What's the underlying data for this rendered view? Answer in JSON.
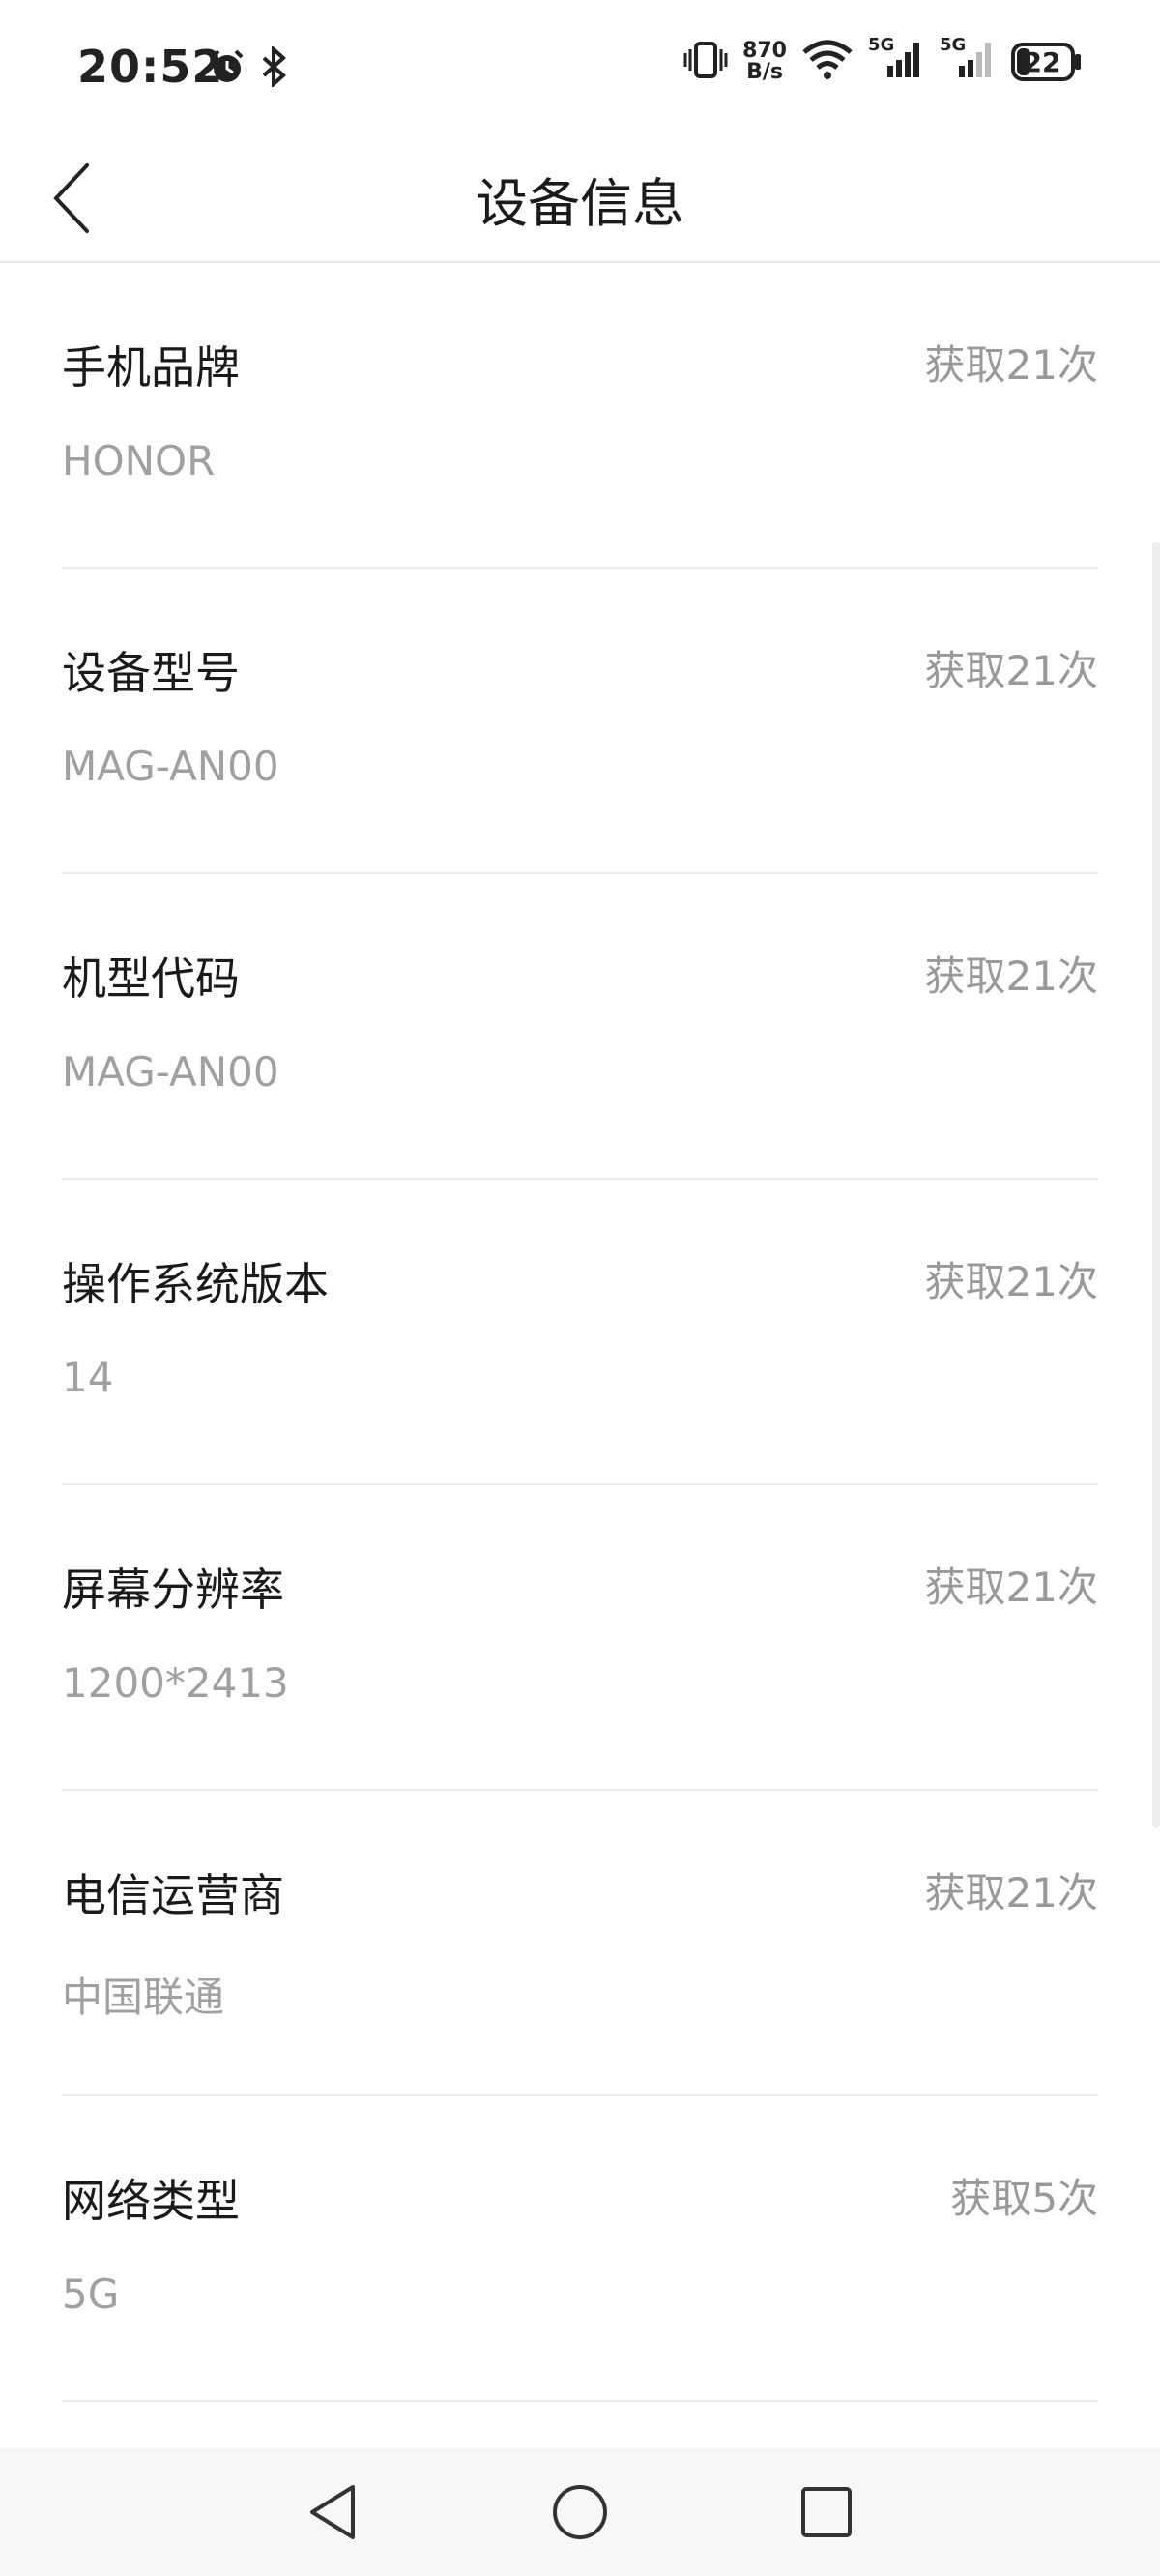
{
  "status_bar": {
    "time": "20:52",
    "speed_value": "870",
    "speed_unit": "B/s",
    "network1": "5G",
    "network2": "5G",
    "battery": "22",
    "icons": [
      "alarm-icon",
      "bluetooth-icon",
      "vibrate-icon",
      "wifi-icon",
      "signal-icon",
      "signal-icon",
      "battery-icon"
    ]
  },
  "header": {
    "title": "设备信息"
  },
  "items": [
    {
      "label": "手机品牌",
      "count": "获取21次",
      "value": "HONOR"
    },
    {
      "label": "设备型号",
      "count": "获取21次",
      "value": "MAG-AN00"
    },
    {
      "label": "机型代码",
      "count": "获取21次",
      "value": "MAG-AN00"
    },
    {
      "label": "操作系统版本",
      "count": "获取21次",
      "value": "14"
    },
    {
      "label": "屏幕分辨率",
      "count": "获取21次",
      "value": "1200*2413"
    },
    {
      "label": "电信运营商",
      "count": "获取21次",
      "value": "中国联通"
    },
    {
      "label": "网络类型",
      "count": "获取5次",
      "value": "5G"
    }
  ],
  "nav": {
    "icons": [
      "back-triangle-icon",
      "home-circle-icon",
      "recents-square-icon"
    ]
  }
}
